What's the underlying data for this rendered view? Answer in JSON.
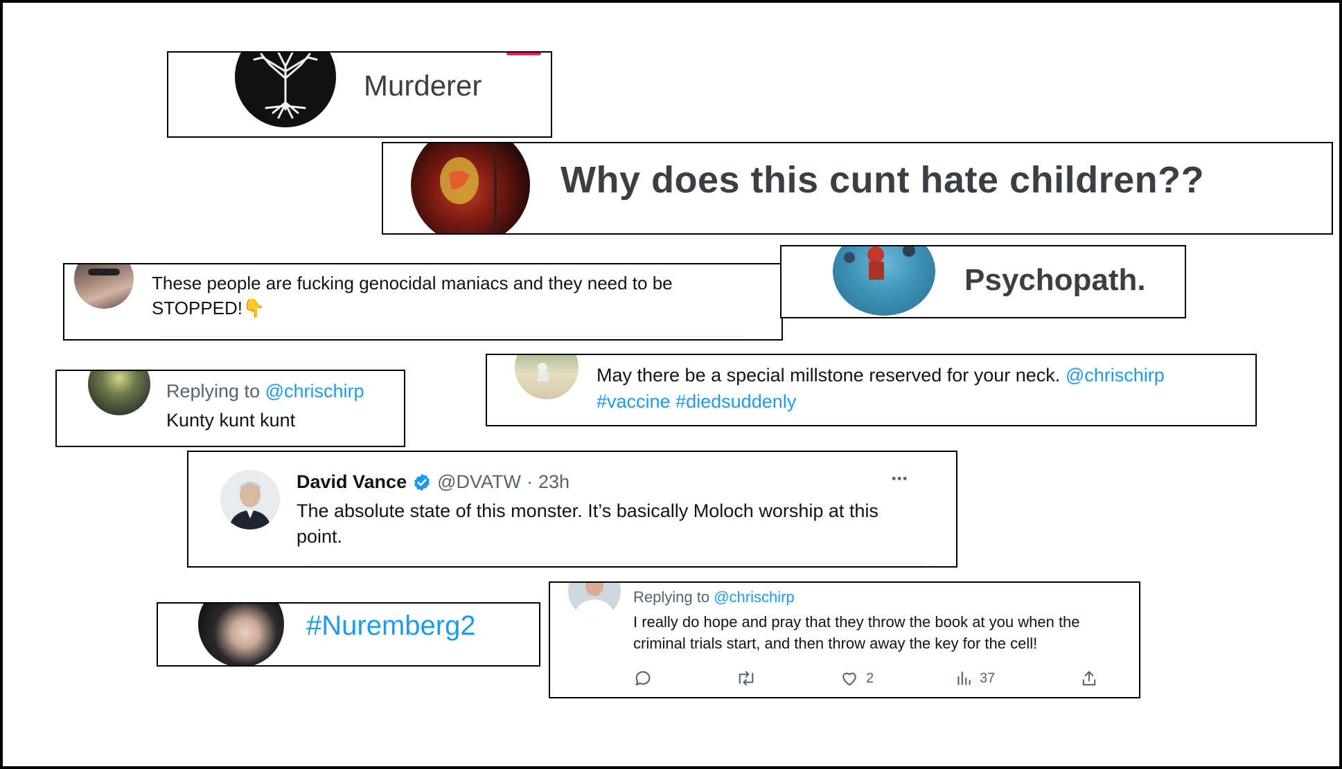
{
  "colors": {
    "link": "#1d9bf0",
    "muted": "#536471",
    "text": "#0f1419"
  },
  "snip1": {
    "text": "Murderer",
    "avatar_icon": "tree-of-life-avatar-icon"
  },
  "snip2": {
    "text": "Why does this cunt hate children??",
    "avatar_icon": "masked-figure-avatar-icon"
  },
  "snip3": {
    "line1": "These people are fucking genocidal maniacs and they need to be",
    "line2": "STOPPED!",
    "emoji": "👇"
  },
  "snip4": {
    "text": "Psychopath."
  },
  "snip5": {
    "replying_to": "Replying to",
    "handle": "@chrischirp",
    "text": "Kunty kunt kunt"
  },
  "snip6": {
    "line1": "May there be a special millstone reserved for your neck.",
    "handle": "@chrischirp",
    "tag1": "#vaccine",
    "tag2": "#diedsuddenly"
  },
  "snip7": {
    "name": "David Vance",
    "handle": "@DVATW",
    "separator": "·",
    "time": "23h",
    "more": "···",
    "line1": "The absolute state of this monster. It’s basically Moloch worship at this",
    "line2": "point."
  },
  "snip8": {
    "text": "#Nuremberg2"
  },
  "snip9": {
    "replying_to": "Replying to",
    "handle": "@chrischirp",
    "line1": "I really do hope and pray that they throw the book at you when the",
    "line2": "criminal trials start, and then throw away the key for the cell!",
    "likes": "2",
    "views": "37"
  }
}
